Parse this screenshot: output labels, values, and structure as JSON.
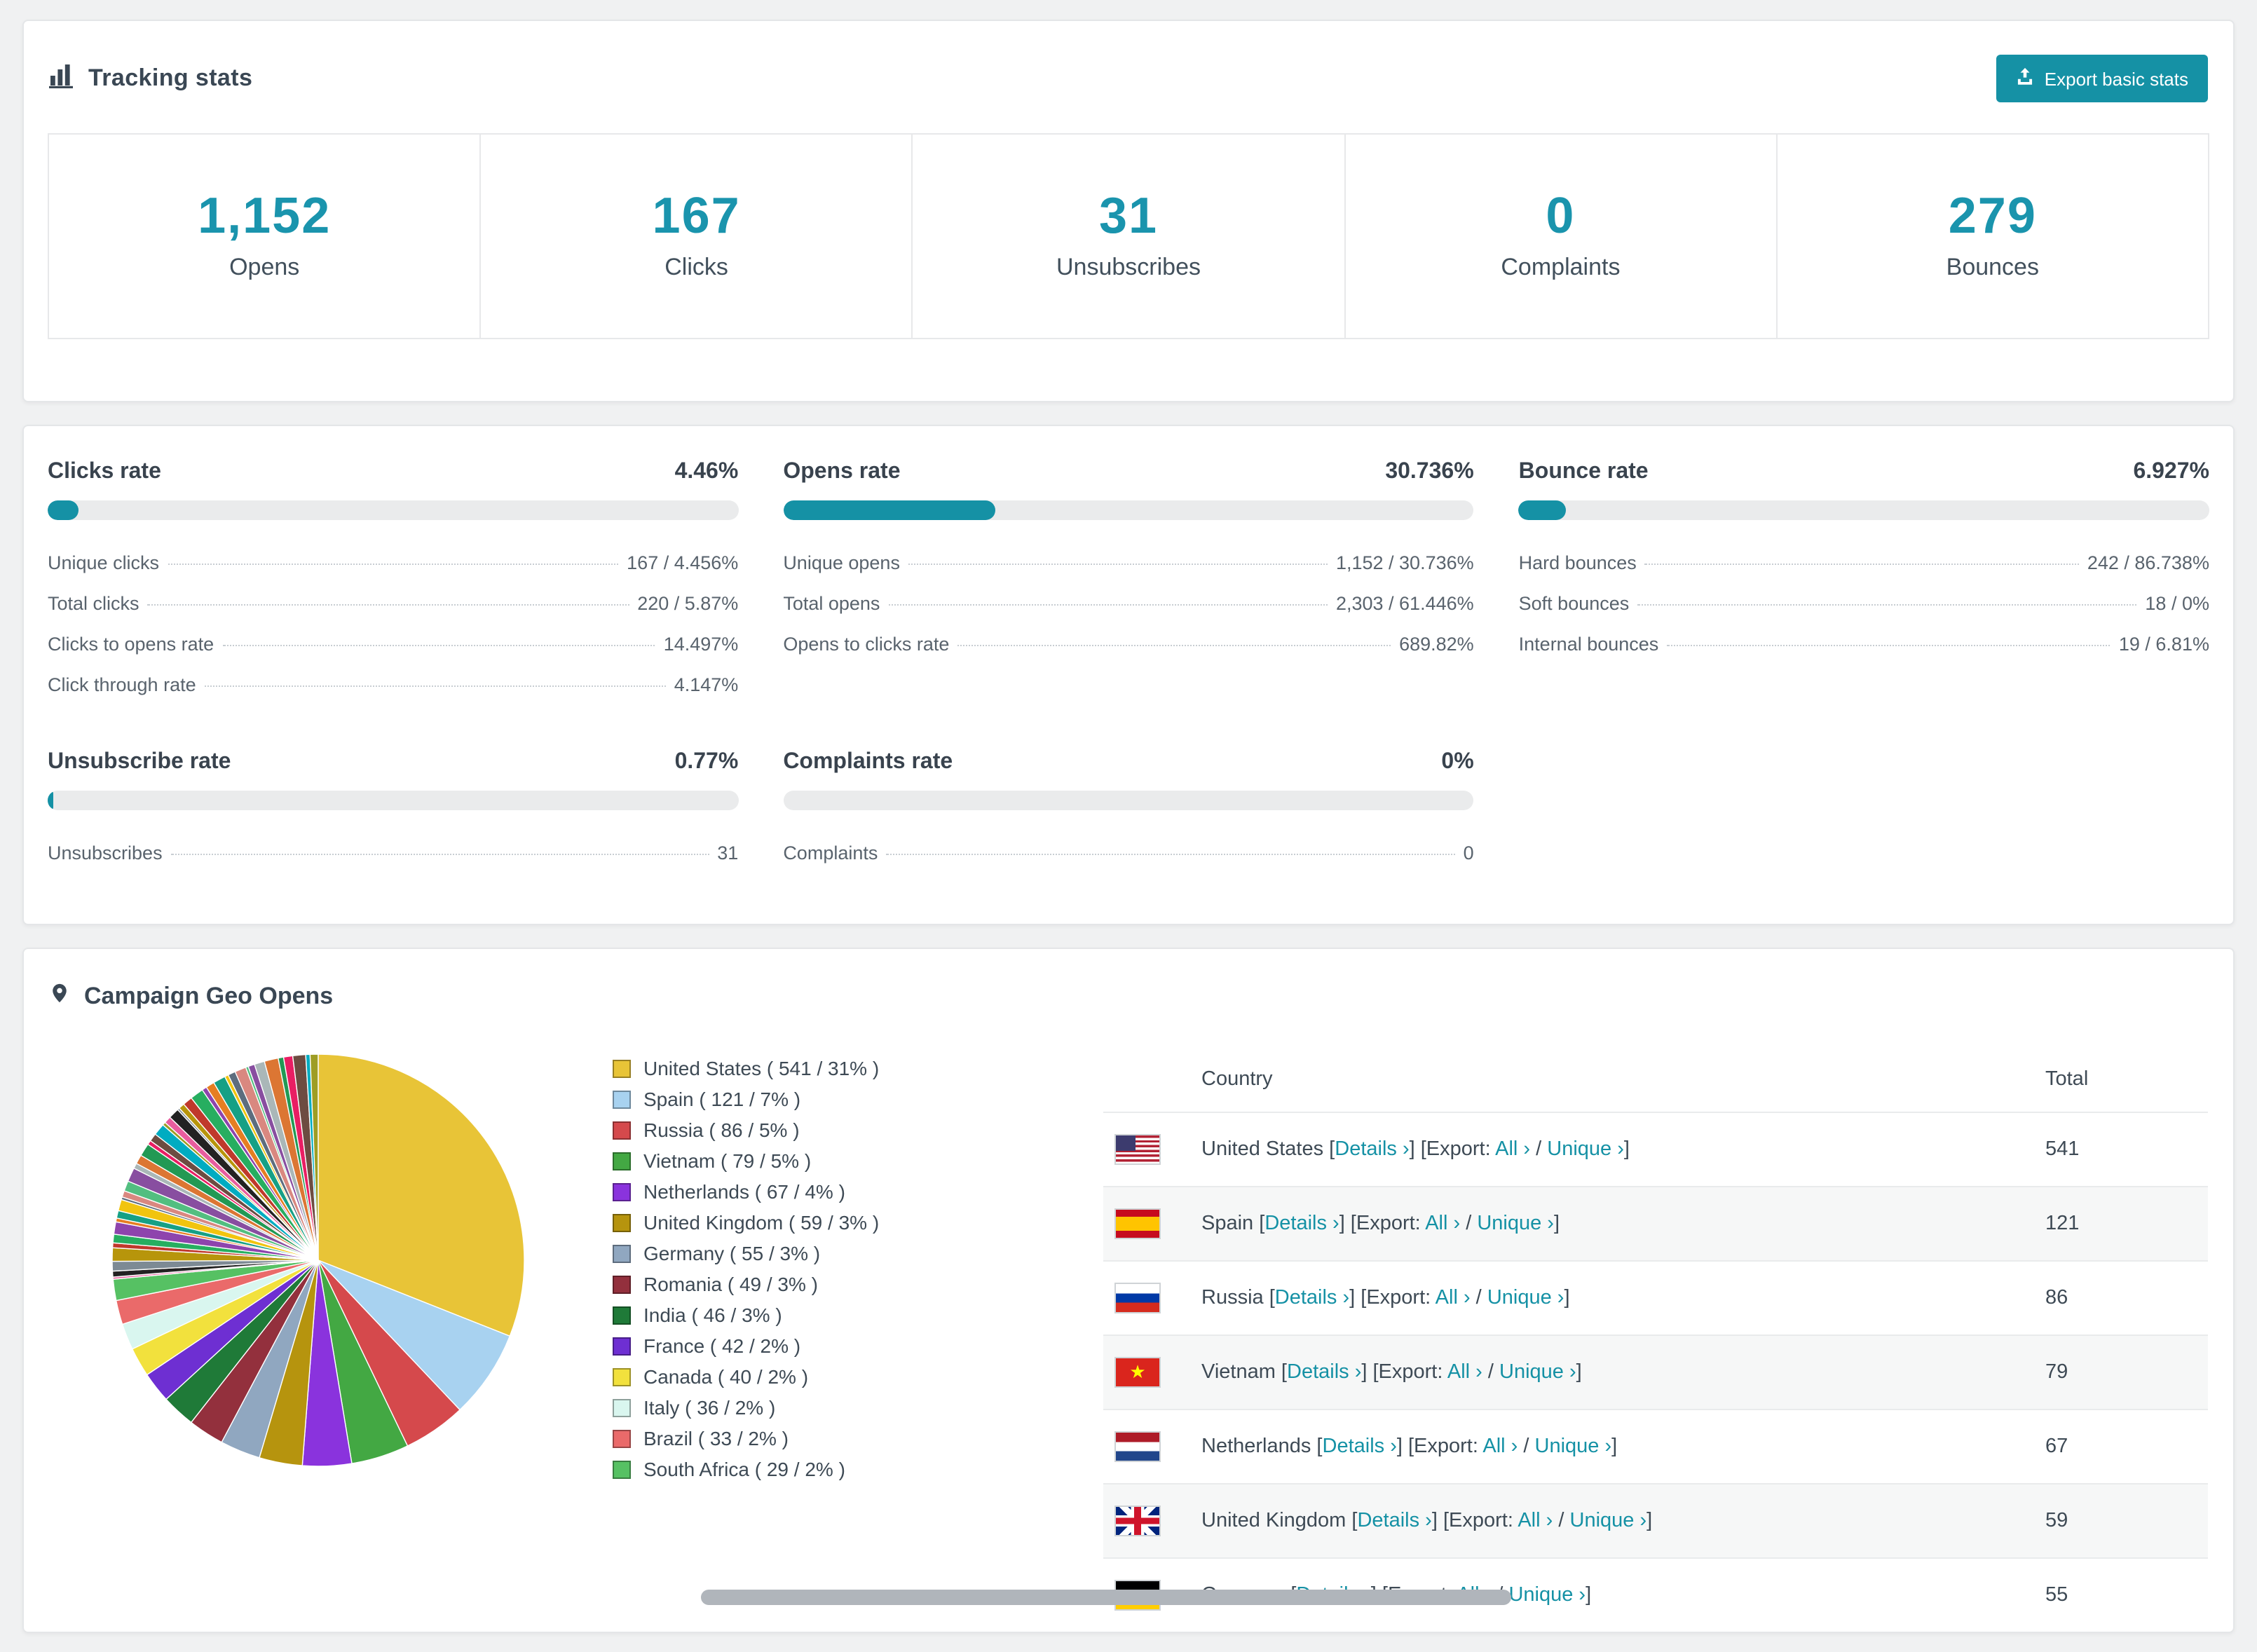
{
  "colors": {
    "accent": "#1591a5",
    "number": "#1a94ad"
  },
  "tracking": {
    "title": "Tracking stats",
    "export_button": "Export basic stats",
    "summary": [
      {
        "value": "1,152",
        "label": "Opens"
      },
      {
        "value": "167",
        "label": "Clicks"
      },
      {
        "value": "31",
        "label": "Unsubscribes"
      },
      {
        "value": "0",
        "label": "Complaints"
      },
      {
        "value": "279",
        "label": "Bounces"
      }
    ]
  },
  "rates": [
    {
      "title": "Clicks rate",
      "value": "4.46%",
      "percent": 4.46,
      "rows": [
        {
          "label": "Unique clicks",
          "value": "167 / 4.456%"
        },
        {
          "label": "Total clicks",
          "value": "220 / 5.87%"
        },
        {
          "label": "Clicks to opens rate",
          "value": "14.497%"
        },
        {
          "label": "Click through rate",
          "value": "4.147%"
        }
      ]
    },
    {
      "title": "Opens rate",
      "value": "30.736%",
      "percent": 30.736,
      "rows": [
        {
          "label": "Unique opens",
          "value": "1,152 / 30.736%"
        },
        {
          "label": "Total opens",
          "value": "2,303 / 61.446%"
        },
        {
          "label": "Opens to clicks rate",
          "value": "689.82%"
        }
      ]
    },
    {
      "title": "Bounce rate",
      "value": "6.927%",
      "percent": 6.927,
      "rows": [
        {
          "label": "Hard bounces",
          "value": "242 / 86.738%"
        },
        {
          "label": "Soft bounces",
          "value": "18 / 0%"
        },
        {
          "label": "Internal bounces",
          "value": "19 / 6.81%"
        }
      ]
    },
    {
      "title": "Unsubscribe rate",
      "value": "0.77%",
      "percent": 0.77,
      "rows": [
        {
          "label": "Unsubscribes",
          "value": "31"
        }
      ]
    },
    {
      "title": "Complaints rate",
      "value": "0%",
      "percent": 0,
      "rows": [
        {
          "label": "Complaints",
          "value": "0"
        }
      ]
    }
  ],
  "geo": {
    "title": "Campaign Geo Opens",
    "chart_data": {
      "type": "pie",
      "title": "Campaign Geo Opens",
      "slices": [
        {
          "name": "United States",
          "value": 541,
          "percent_label": "31%",
          "legend_label": "United States ( 541 / 31% )",
          "color": "#e8c437"
        },
        {
          "name": "Spain",
          "value": 121,
          "percent_label": "7%",
          "legend_label": "Spain ( 121 / 7% )",
          "color": "#a8d2f0"
        },
        {
          "name": "Russia",
          "value": 86,
          "percent_label": "5%",
          "legend_label": "Russia ( 86 / 5% )",
          "color": "#d5494c"
        },
        {
          "name": "Vietnam",
          "value": 79,
          "percent_label": "5%",
          "legend_label": "Vietnam ( 79 / 5% )",
          "color": "#43a843"
        },
        {
          "name": "Netherlands",
          "value": 67,
          "percent_label": "4%",
          "legend_label": "Netherlands ( 67 / 4% )",
          "color": "#8a33dd"
        },
        {
          "name": "United Kingdom",
          "value": 59,
          "percent_label": "3%",
          "legend_label": "United Kingdom ( 59 / 3% )",
          "color": "#b6940e"
        },
        {
          "name": "Germany",
          "value": 55,
          "percent_label": "3%",
          "legend_label": "Germany ( 55 / 3% )",
          "color": "#90a7c0"
        },
        {
          "name": "Romania",
          "value": 49,
          "percent_label": "3%",
          "legend_label": "Romania ( 49 / 3% )",
          "color": "#93303d"
        },
        {
          "name": "India",
          "value": 46,
          "percent_label": "3%",
          "legend_label": "India ( 46 / 3% )",
          "color": "#1f7a38"
        },
        {
          "name": "France",
          "value": 42,
          "percent_label": "2%",
          "legend_label": "France ( 42 / 2% )",
          "color": "#6e2fd2"
        },
        {
          "name": "Canada",
          "value": 40,
          "percent_label": "2%",
          "legend_label": "Canada ( 40 / 2% )",
          "color": "#f2e13d"
        },
        {
          "name": "Italy",
          "value": 36,
          "percent_label": "2%",
          "legend_label": "Italy ( 36 / 2% )",
          "color": "#d9f6ef"
        },
        {
          "name": "Brazil",
          "value": 33,
          "percent_label": "2%",
          "legend_label": "Brazil ( 33 / 2% )",
          "color": "#ea6a6a"
        },
        {
          "name": "South Africa",
          "value": 29,
          "percent_label": "2%",
          "legend_label": "South Africa ( 29 / 2% )",
          "color": "#56c163"
        }
      ],
      "others": {
        "total": 462,
        "count": 42,
        "palette": [
          "#e85d9e",
          "#222222",
          "#7d8a94",
          "#b7950b",
          "#c0392b",
          "#27ae60",
          "#8e44ad",
          "#e67e22",
          "#16a085",
          "#f1c40f",
          "#5d6d7e",
          "#d98880",
          "#52be80",
          "#884ea0",
          "#aab7b8",
          "#dc7633",
          "#229954",
          "#e91e63",
          "#6d4c41",
          "#00acc1",
          "#9e9d24"
        ]
      }
    },
    "table": {
      "headers": {
        "country": "Country",
        "total": "Total"
      },
      "labels": {
        "b1": " [",
        "details": "Details ›",
        "b2": "] [Export: ",
        "all": "All ›",
        "b3": " / ",
        "unique": "Unique ›",
        "b4": "]"
      },
      "rows": [
        {
          "country": "United States",
          "total": "541",
          "flag": "us"
        },
        {
          "country": "Spain",
          "total": "121",
          "flag": "es"
        },
        {
          "country": "Russia",
          "total": "86",
          "flag": "ru"
        },
        {
          "country": "Vietnam",
          "total": "79",
          "flag": "vn"
        },
        {
          "country": "Netherlands",
          "total": "67",
          "flag": "nl"
        },
        {
          "country": "United Kingdom",
          "total": "59",
          "flag": "gb"
        },
        {
          "country": "Germany",
          "total": "55",
          "flag": "de"
        }
      ]
    }
  }
}
